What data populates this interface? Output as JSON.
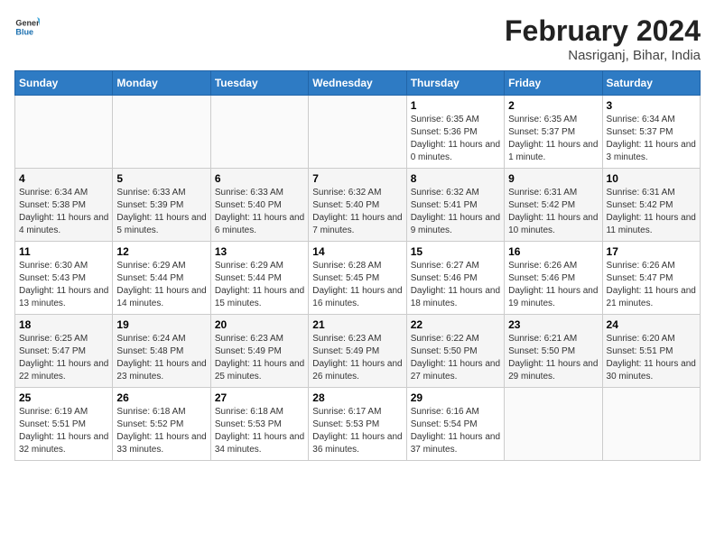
{
  "header": {
    "logo_general": "General",
    "logo_blue": "Blue",
    "month_title": "February 2024",
    "location": "Nasriganj, Bihar, India"
  },
  "days_of_week": [
    "Sunday",
    "Monday",
    "Tuesday",
    "Wednesday",
    "Thursday",
    "Friday",
    "Saturday"
  ],
  "weeks": [
    {
      "days": [
        {
          "num": "",
          "sunrise": "",
          "sunset": "",
          "daylight": "",
          "empty": true
        },
        {
          "num": "",
          "sunrise": "",
          "sunset": "",
          "daylight": "",
          "empty": true
        },
        {
          "num": "",
          "sunrise": "",
          "sunset": "",
          "daylight": "",
          "empty": true
        },
        {
          "num": "",
          "sunrise": "",
          "sunset": "",
          "daylight": "",
          "empty": true
        },
        {
          "num": "1",
          "sunrise": "Sunrise: 6:35 AM",
          "sunset": "Sunset: 5:36 PM",
          "daylight": "Daylight: 11 hours and 0 minutes.",
          "empty": false
        },
        {
          "num": "2",
          "sunrise": "Sunrise: 6:35 AM",
          "sunset": "Sunset: 5:37 PM",
          "daylight": "Daylight: 11 hours and 1 minute.",
          "empty": false
        },
        {
          "num": "3",
          "sunrise": "Sunrise: 6:34 AM",
          "sunset": "Sunset: 5:37 PM",
          "daylight": "Daylight: 11 hours and 3 minutes.",
          "empty": false
        }
      ]
    },
    {
      "days": [
        {
          "num": "4",
          "sunrise": "Sunrise: 6:34 AM",
          "sunset": "Sunset: 5:38 PM",
          "daylight": "Daylight: 11 hours and 4 minutes.",
          "empty": false
        },
        {
          "num": "5",
          "sunrise": "Sunrise: 6:33 AM",
          "sunset": "Sunset: 5:39 PM",
          "daylight": "Daylight: 11 hours and 5 minutes.",
          "empty": false
        },
        {
          "num": "6",
          "sunrise": "Sunrise: 6:33 AM",
          "sunset": "Sunset: 5:40 PM",
          "daylight": "Daylight: 11 hours and 6 minutes.",
          "empty": false
        },
        {
          "num": "7",
          "sunrise": "Sunrise: 6:32 AM",
          "sunset": "Sunset: 5:40 PM",
          "daylight": "Daylight: 11 hours and 7 minutes.",
          "empty": false
        },
        {
          "num": "8",
          "sunrise": "Sunrise: 6:32 AM",
          "sunset": "Sunset: 5:41 PM",
          "daylight": "Daylight: 11 hours and 9 minutes.",
          "empty": false
        },
        {
          "num": "9",
          "sunrise": "Sunrise: 6:31 AM",
          "sunset": "Sunset: 5:42 PM",
          "daylight": "Daylight: 11 hours and 10 minutes.",
          "empty": false
        },
        {
          "num": "10",
          "sunrise": "Sunrise: 6:31 AM",
          "sunset": "Sunset: 5:42 PM",
          "daylight": "Daylight: 11 hours and 11 minutes.",
          "empty": false
        }
      ]
    },
    {
      "days": [
        {
          "num": "11",
          "sunrise": "Sunrise: 6:30 AM",
          "sunset": "Sunset: 5:43 PM",
          "daylight": "Daylight: 11 hours and 13 minutes.",
          "empty": false
        },
        {
          "num": "12",
          "sunrise": "Sunrise: 6:29 AM",
          "sunset": "Sunset: 5:44 PM",
          "daylight": "Daylight: 11 hours and 14 minutes.",
          "empty": false
        },
        {
          "num": "13",
          "sunrise": "Sunrise: 6:29 AM",
          "sunset": "Sunset: 5:44 PM",
          "daylight": "Daylight: 11 hours and 15 minutes.",
          "empty": false
        },
        {
          "num": "14",
          "sunrise": "Sunrise: 6:28 AM",
          "sunset": "Sunset: 5:45 PM",
          "daylight": "Daylight: 11 hours and 16 minutes.",
          "empty": false
        },
        {
          "num": "15",
          "sunrise": "Sunrise: 6:27 AM",
          "sunset": "Sunset: 5:46 PM",
          "daylight": "Daylight: 11 hours and 18 minutes.",
          "empty": false
        },
        {
          "num": "16",
          "sunrise": "Sunrise: 6:26 AM",
          "sunset": "Sunset: 5:46 PM",
          "daylight": "Daylight: 11 hours and 19 minutes.",
          "empty": false
        },
        {
          "num": "17",
          "sunrise": "Sunrise: 6:26 AM",
          "sunset": "Sunset: 5:47 PM",
          "daylight": "Daylight: 11 hours and 21 minutes.",
          "empty": false
        }
      ]
    },
    {
      "days": [
        {
          "num": "18",
          "sunrise": "Sunrise: 6:25 AM",
          "sunset": "Sunset: 5:47 PM",
          "daylight": "Daylight: 11 hours and 22 minutes.",
          "empty": false
        },
        {
          "num": "19",
          "sunrise": "Sunrise: 6:24 AM",
          "sunset": "Sunset: 5:48 PM",
          "daylight": "Daylight: 11 hours and 23 minutes.",
          "empty": false
        },
        {
          "num": "20",
          "sunrise": "Sunrise: 6:23 AM",
          "sunset": "Sunset: 5:49 PM",
          "daylight": "Daylight: 11 hours and 25 minutes.",
          "empty": false
        },
        {
          "num": "21",
          "sunrise": "Sunrise: 6:23 AM",
          "sunset": "Sunset: 5:49 PM",
          "daylight": "Daylight: 11 hours and 26 minutes.",
          "empty": false
        },
        {
          "num": "22",
          "sunrise": "Sunrise: 6:22 AM",
          "sunset": "Sunset: 5:50 PM",
          "daylight": "Daylight: 11 hours and 27 minutes.",
          "empty": false
        },
        {
          "num": "23",
          "sunrise": "Sunrise: 6:21 AM",
          "sunset": "Sunset: 5:50 PM",
          "daylight": "Daylight: 11 hours and 29 minutes.",
          "empty": false
        },
        {
          "num": "24",
          "sunrise": "Sunrise: 6:20 AM",
          "sunset": "Sunset: 5:51 PM",
          "daylight": "Daylight: 11 hours and 30 minutes.",
          "empty": false
        }
      ]
    },
    {
      "days": [
        {
          "num": "25",
          "sunrise": "Sunrise: 6:19 AM",
          "sunset": "Sunset: 5:51 PM",
          "daylight": "Daylight: 11 hours and 32 minutes.",
          "empty": false
        },
        {
          "num": "26",
          "sunrise": "Sunrise: 6:18 AM",
          "sunset": "Sunset: 5:52 PM",
          "daylight": "Daylight: 11 hours and 33 minutes.",
          "empty": false
        },
        {
          "num": "27",
          "sunrise": "Sunrise: 6:18 AM",
          "sunset": "Sunset: 5:53 PM",
          "daylight": "Daylight: 11 hours and 34 minutes.",
          "empty": false
        },
        {
          "num": "28",
          "sunrise": "Sunrise: 6:17 AM",
          "sunset": "Sunset: 5:53 PM",
          "daylight": "Daylight: 11 hours and 36 minutes.",
          "empty": false
        },
        {
          "num": "29",
          "sunrise": "Sunrise: 6:16 AM",
          "sunset": "Sunset: 5:54 PM",
          "daylight": "Daylight: 11 hours and 37 minutes.",
          "empty": false
        },
        {
          "num": "",
          "sunrise": "",
          "sunset": "",
          "daylight": "",
          "empty": true
        },
        {
          "num": "",
          "sunrise": "",
          "sunset": "",
          "daylight": "",
          "empty": true
        }
      ]
    }
  ]
}
